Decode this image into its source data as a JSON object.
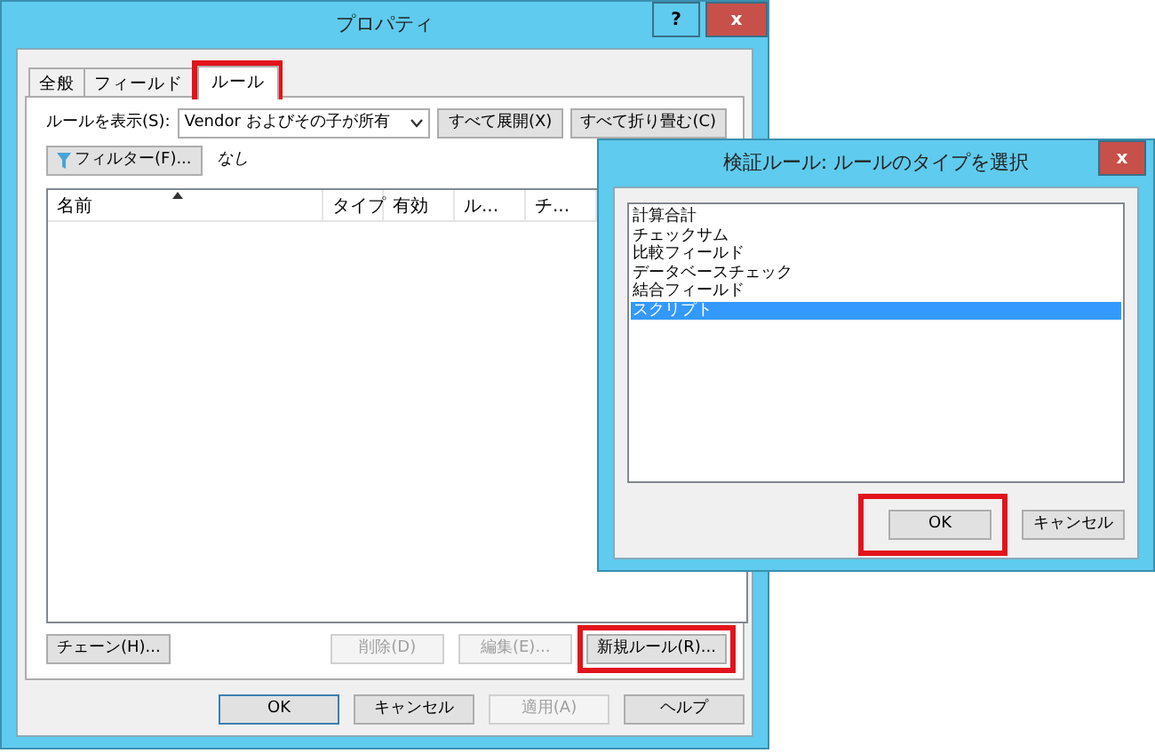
{
  "window": {
    "title": "プロパティ",
    "help_button": "?",
    "close_button": "x"
  },
  "tabs": [
    {
      "label": "全般",
      "selected": false,
      "highlighted": false
    },
    {
      "label": "フィールド",
      "selected": false,
      "highlighted": false
    },
    {
      "label": "ルール",
      "selected": true,
      "highlighted": true
    }
  ],
  "show_rules": {
    "label": "ルールを表示(S):",
    "value": "Vendor およびその子が所有"
  },
  "expand_buttons": [
    {
      "label": "すべて展開(X)"
    },
    {
      "label": "すべて折り畳む(C)"
    }
  ],
  "filter": {
    "button": "フィルター(F)...",
    "value": "なし"
  },
  "columns": [
    {
      "label": "名前",
      "sorted": true
    },
    {
      "label": "タイプ",
      "sorted": false
    },
    {
      "label": "有効",
      "sorted": false
    },
    {
      "label": "ル...",
      "sorted": false
    },
    {
      "label": "チ...",
      "sorted": false
    }
  ],
  "rule_buttons": [
    {
      "label": "チェーン(H)...",
      "disabled": false,
      "highlighted": false
    },
    {
      "label": "削除(D)",
      "disabled": true,
      "highlighted": false
    },
    {
      "label": "編集(E)...",
      "disabled": true,
      "highlighted": false
    },
    {
      "label": "新規ルール(R)...",
      "disabled": false,
      "highlighted": true
    }
  ],
  "footer_buttons": [
    {
      "label": "OK",
      "disabled": false
    },
    {
      "label": "キャンセル",
      "disabled": false
    },
    {
      "label": "適用(A)",
      "disabled": true
    },
    {
      "label": "ヘルプ",
      "disabled": false
    }
  ],
  "dialog": {
    "title": "検証ルール: ルールのタイプを選択",
    "close_button": "x",
    "items": [
      {
        "label": "計算合計",
        "selected": false
      },
      {
        "label": "チェックサム",
        "selected": false
      },
      {
        "label": "比較フィールド",
        "selected": false
      },
      {
        "label": "データベースチェック",
        "selected": false
      },
      {
        "label": "結合フィールド",
        "selected": false
      },
      {
        "label": "スクリプト",
        "selected": true
      }
    ],
    "buttons": [
      {
        "label": "OK",
        "highlighted": true
      },
      {
        "label": "キャンセル",
        "highlighted": false
      }
    ]
  }
}
